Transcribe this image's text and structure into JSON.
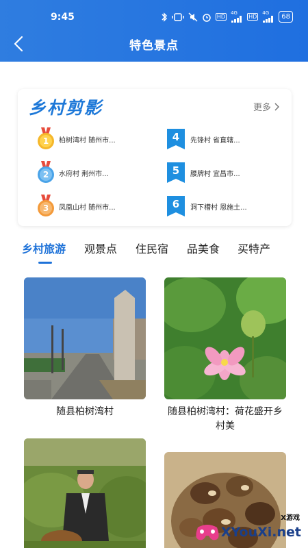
{
  "status": {
    "time": "9:45",
    "battery": "68",
    "net1": "4G",
    "net2": "4G",
    "hd1": "HD",
    "hd2": "HD"
  },
  "header": {
    "title": "特色景点"
  },
  "ranking": {
    "logo": "乡村剪影",
    "more": "更多",
    "items": [
      {
        "rank": "1",
        "text": "柏树湾村  随州市..."
      },
      {
        "rank": "2",
        "text": "水府村  荆州市..."
      },
      {
        "rank": "3",
        "text": "凤凰山村  随州市..."
      },
      {
        "rank": "4",
        "text": "先锋村  省直辖..."
      },
      {
        "rank": "5",
        "text": "腰牌村  宜昌市..."
      },
      {
        "rank": "6",
        "text": "洞下槽村  恩施土..."
      }
    ]
  },
  "tabs": [
    {
      "label": "乡村旅游",
      "active": true
    },
    {
      "label": "观景点"
    },
    {
      "label": "住民宿"
    },
    {
      "label": "品美食"
    },
    {
      "label": "买特产"
    }
  ],
  "cards": [
    {
      "caption": "随县柏树湾村"
    },
    {
      "caption": "随县柏树湾村：荷花盛开乡村美"
    },
    {
      "caption": ""
    },
    {
      "caption": ""
    }
  ],
  "watermark": {
    "text": "XYouXi.net",
    "small": "X游戏"
  },
  "colors": {
    "brand": "#1e72d8",
    "header_start": "#2f7de0",
    "header_end": "#1f6fe0",
    "gold": "#f5b72b",
    "silver_blue": "#4aa3e8",
    "orange": "#f39a3a"
  }
}
